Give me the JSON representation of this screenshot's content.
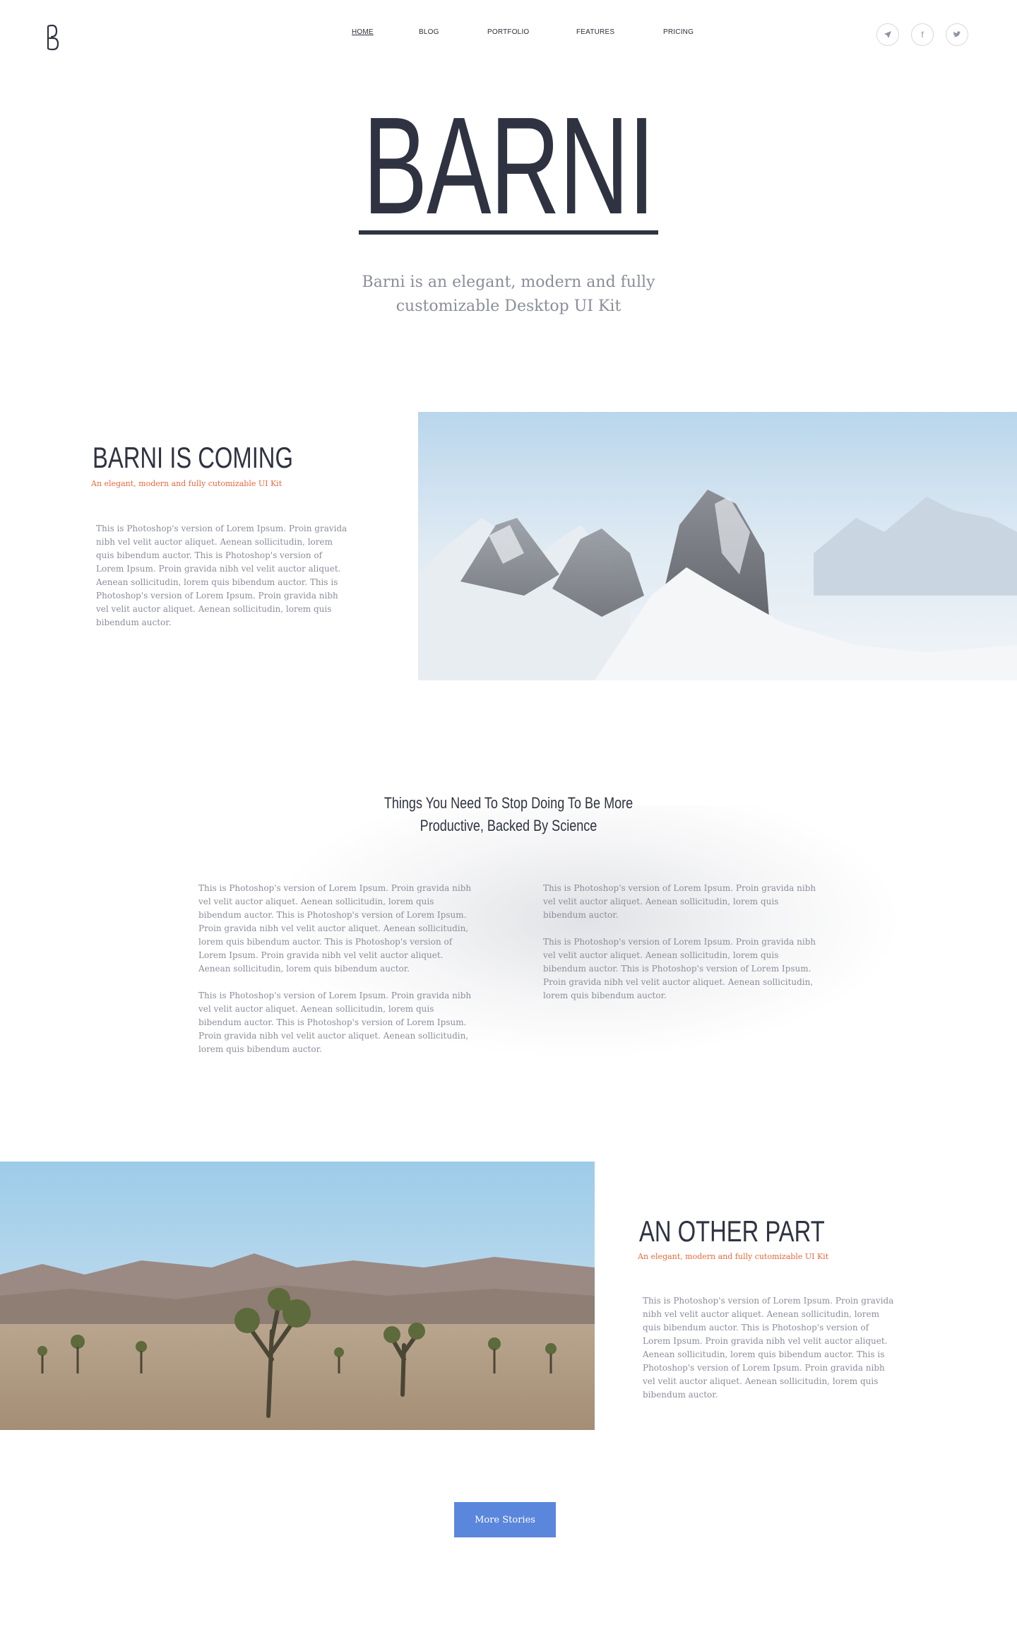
{
  "header": {
    "logo_icon": "barni-logo-icon",
    "nav": [
      {
        "label": "HOME",
        "active": true
      },
      {
        "label": "BLOG",
        "active": false
      },
      {
        "label": "PORTFOLIO",
        "active": false
      },
      {
        "label": "FEATURES",
        "active": false
      },
      {
        "label": "PRICING",
        "active": false
      }
    ],
    "social": [
      {
        "icon": "send-icon",
        "glyph": "➤"
      },
      {
        "icon": "facebook-icon",
        "glyph": "f"
      },
      {
        "icon": "twitter-icon",
        "glyph": "🐦"
      }
    ]
  },
  "hero": {
    "title": "BARNI",
    "subtitle_line1": "Barni is an elegant, modern and fully",
    "subtitle_line2": "customizable Desktop UI Kit"
  },
  "section1": {
    "title": "BARNI IS COMING",
    "kicker": "An elegant, modern and fully cutomizable UI Kit",
    "body": "This is Photoshop's version  of Lorem Ipsum. Proin gravida nibh vel velit auctor aliquet. Aenean sollicitudin, lorem quis bibendum auctor. This is     Photoshop's version  of Lorem Ipsum. Proin gravida nibh vel velit auctor aliquet. Aenean sollicitudin, lorem quis bibendum auctor. This is Photoshop's version  of Lorem Ipsum. Proin gravida nibh vel velit auctor aliquet. Aenean sollicitudin, lorem quis bibendum auctor.",
    "image": "snowy-mountains-photo"
  },
  "article": {
    "title_line1": "Things You Need To Stop Doing To Be More",
    "title_line2": "Productive, Backed By Science",
    "col1_p1": "This is Photoshop's version  of Lorem Ipsum. Proin gravida nibh vel velit auctor aliquet. Aenean sollicitudin, lorem quis bibendum auctor. This is Photoshop's version  of Lorem Ipsum. Proin gravida nibh vel velit auctor aliquet. Aenean sollicitudin, lorem quis bibendum auctor. This is Photoshop's version  of Lorem Ipsum. Proin gravida nibh vel velit auctor aliquet. Aenean sollicitudin, lorem quis bibendum auctor.",
    "col1_p2": "This is Photoshop's version  of Lorem Ipsum. Proin gravida nibh vel velit auctor aliquet. Aenean sollicitudin, lorem quis bibendum auctor. This is Photoshop's version  of Lorem Ipsum. Proin gravida nibh vel velit auctor aliquet. Aenean sollicitudin, lorem quis bibendum auctor.",
    "col2_p1": "This is Photoshop's version  of Lorem Ipsum. Proin gravida nibh vel velit auctor aliquet. Aenean sollicitudin, lorem quis bibendum auctor.",
    "col2_p2": "This is Photoshop's version  of Lorem Ipsum. Proin gravida nibh vel velit auctor aliquet. Aenean sollicitudin, lorem quis bibendum auctor. This is Photoshop's version  of Lorem Ipsum. Proin gravida nibh vel velit auctor aliquet. Aenean sollicitudin, lorem quis bibendum auctor.",
    "background": "bridge-photo-faded"
  },
  "section2": {
    "title": "AN OTHER PART",
    "kicker": "An elegant, modern and fully cutomizable UI Kit",
    "body": "This is Photoshop's version  of Lorem Ipsum. Proin gravida nibh vel velit auctor aliquet. Aenean sollicitudin, lorem quis bibendum auctor. This is     Photoshop's version  of Lorem Ipsum. Proin gravida nibh vel velit auctor aliquet. Aenean sollicitudin, lorem quis bibendum auctor. This is Photoshop's version  of Lorem Ipsum. Proin gravida nibh vel velit auctor aliquet. Aenean sollicitudin, lorem quis bibendum auctor.",
    "image": "joshua-tree-desert-photo"
  },
  "footer": {
    "more_button": "More Stories"
  },
  "colors": {
    "dark": "#2f3341",
    "muted": "#8a8e99",
    "accent_orange": "#e8683c",
    "button_blue": "#5a87dc"
  }
}
